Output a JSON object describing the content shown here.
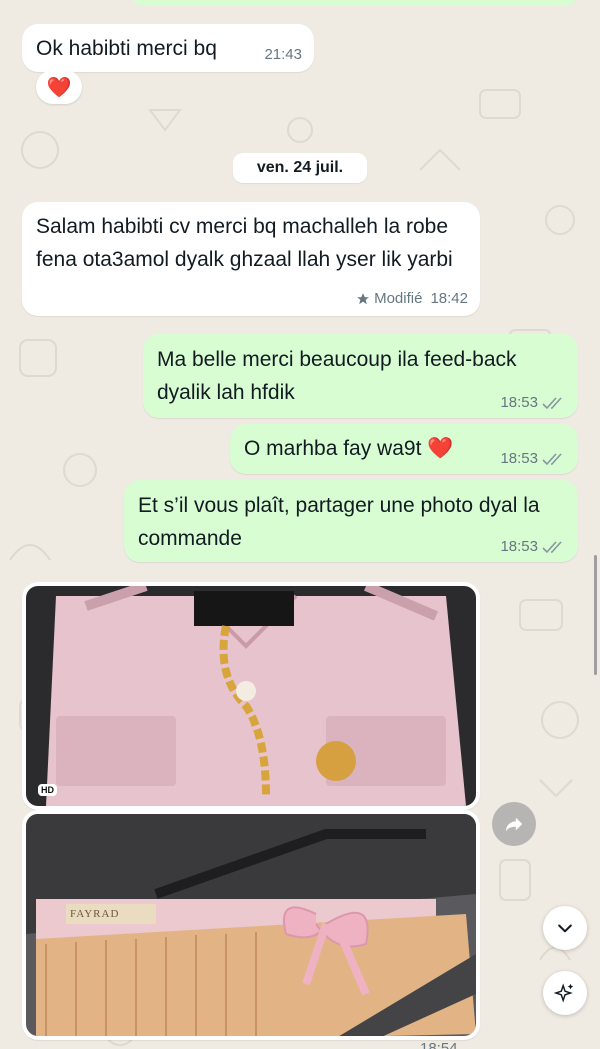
{
  "messages": {
    "m1": {
      "text": "Ok habibti merci bq",
      "time": "21:43",
      "reaction": "❤️"
    },
    "date_separator": "ven. 24 juil.",
    "m2": {
      "text": "Salam habibti cv merci bq machalleh la robe fena ota3amol dyalk ghzaal llah yser lik yarbi",
      "edited": "Modifié",
      "time": "18:42"
    },
    "m3": {
      "text": "Ma belle merci beaucoup ila feed-back dyalik lah hfdik",
      "time": "18:53"
    },
    "m4": {
      "text": "O marhba fay wa9t ❤️",
      "time": "18:53"
    },
    "m5": {
      "text": "Et s’il vous plaît, partager une photo dyal la commande",
      "time": "18:53"
    },
    "photo1": {
      "badge": "HD"
    },
    "photo2": {
      "brand": "FAYRAD",
      "time_partial": "18:54"
    }
  },
  "icons": {
    "edited": "star-icon",
    "read": "double-check-icon",
    "forward": "forward-icon",
    "scroll_down": "chevron-down-icon",
    "ai": "sparkle-icon"
  },
  "colors": {
    "incoming": "#ffffff",
    "outgoing": "#d9fdd3",
    "wallpaper": "#efeae2",
    "meta": "#667781"
  }
}
